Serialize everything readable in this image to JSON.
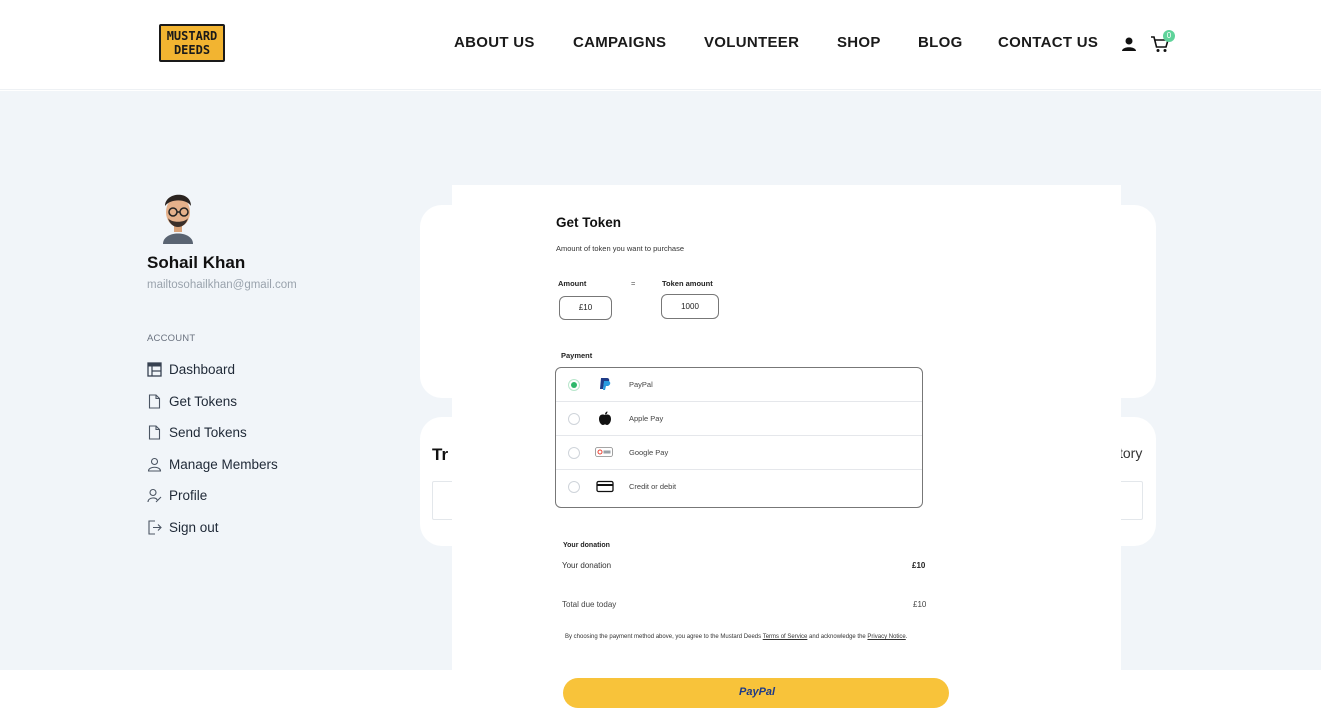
{
  "brand": {
    "logo_line1": "MUSTARD",
    "logo_line2": "DEEDS"
  },
  "nav": {
    "items": [
      "ABOUT US",
      "CAMPAIGNS",
      "VOLUNTEER",
      "SHOP",
      "BLOG",
      "CONTACT US"
    ],
    "cart_count": "0"
  },
  "profile": {
    "name": "Sohail Khan",
    "email": "mailtosohailkhan@gmail.com",
    "section_label": "ACCOUNT",
    "menu": [
      "Dashboard",
      "Get Tokens",
      "Send Tokens",
      "Manage Members",
      "Profile",
      "Sign out"
    ]
  },
  "background_card": {
    "heading_fragment": "Tr",
    "link_fragment": "tory"
  },
  "modal": {
    "title": "Get Token",
    "subtitle": "Amount of token you want to purchase",
    "amount_label": "Amount",
    "equals": "=",
    "token_label": "Token amount",
    "amount_value": "£10",
    "token_value": "1000",
    "payment_label": "Payment",
    "payment_methods": [
      {
        "label": "PayPal",
        "icon": "paypal-icon",
        "selected": true
      },
      {
        "label": "Apple Pay",
        "icon": "apple-icon",
        "selected": false
      },
      {
        "label": "Google Pay",
        "icon": "google-pay-icon",
        "selected": false
      },
      {
        "label": "Credit or debit",
        "icon": "credit-card-icon",
        "selected": false
      }
    ],
    "donation_heading": "Your donation",
    "donation_label": "Your donation",
    "donation_value": "£10",
    "total_label": "Total due today",
    "total_value": "£10",
    "legal_prefix": "By choosing the payment method above, you agree to the Mustard Deeds ",
    "legal_terms": "Terms of Service",
    "legal_middle": " and acknowledge the ",
    "legal_privacy": "Privacy Notice",
    "legal_suffix": ".",
    "paypal_button": "PayPal"
  },
  "colors": {
    "accent_green": "#2fb86b",
    "brand_mustard": "#f2b431",
    "paypal_yellow": "#f8c33a",
    "page_bg": "#f1f5f9"
  }
}
